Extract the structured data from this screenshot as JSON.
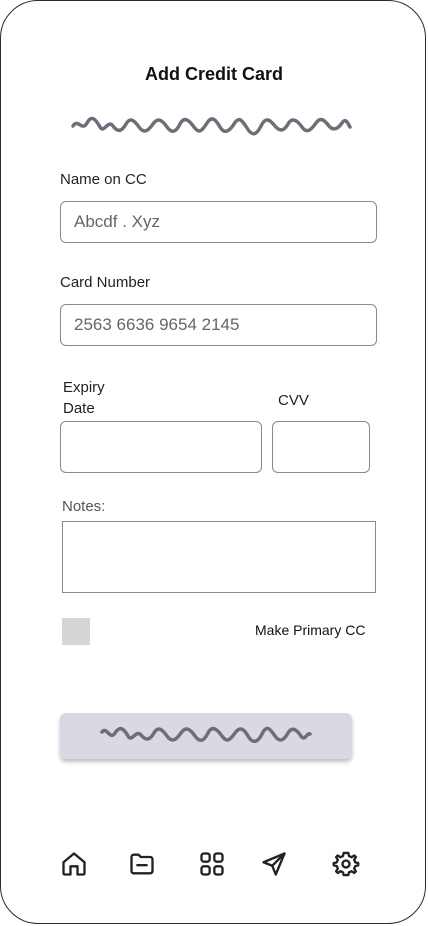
{
  "header": {
    "title": "Add Credit Card"
  },
  "form": {
    "name_label": "Name  on CC",
    "name_value": "Abcdf .  Xyz",
    "card_label": "Card Number",
    "card_value": "2563 6636 9654 2145",
    "expiry_label_line1": "Expiry",
    "expiry_label_line2": "Date",
    "expiry_value": "",
    "cvv_label": "CVV",
    "cvv_value": "",
    "notes_label": "Notes:",
    "notes_value": "",
    "primary_checkbox_label": "Make Primary CC",
    "primary_checked": false
  },
  "bottom_nav": {
    "items": [
      {
        "icon": "home-icon"
      },
      {
        "icon": "folder-minus-icon"
      },
      {
        "icon": "grid-icon"
      },
      {
        "icon": "send-icon"
      },
      {
        "icon": "settings-icon"
      }
    ]
  },
  "colors": {
    "border": "#8a8a8a",
    "button_bg": "#d9d9e3",
    "squiggle": "#6e6e78",
    "checkbox": "#d6d6d6"
  }
}
